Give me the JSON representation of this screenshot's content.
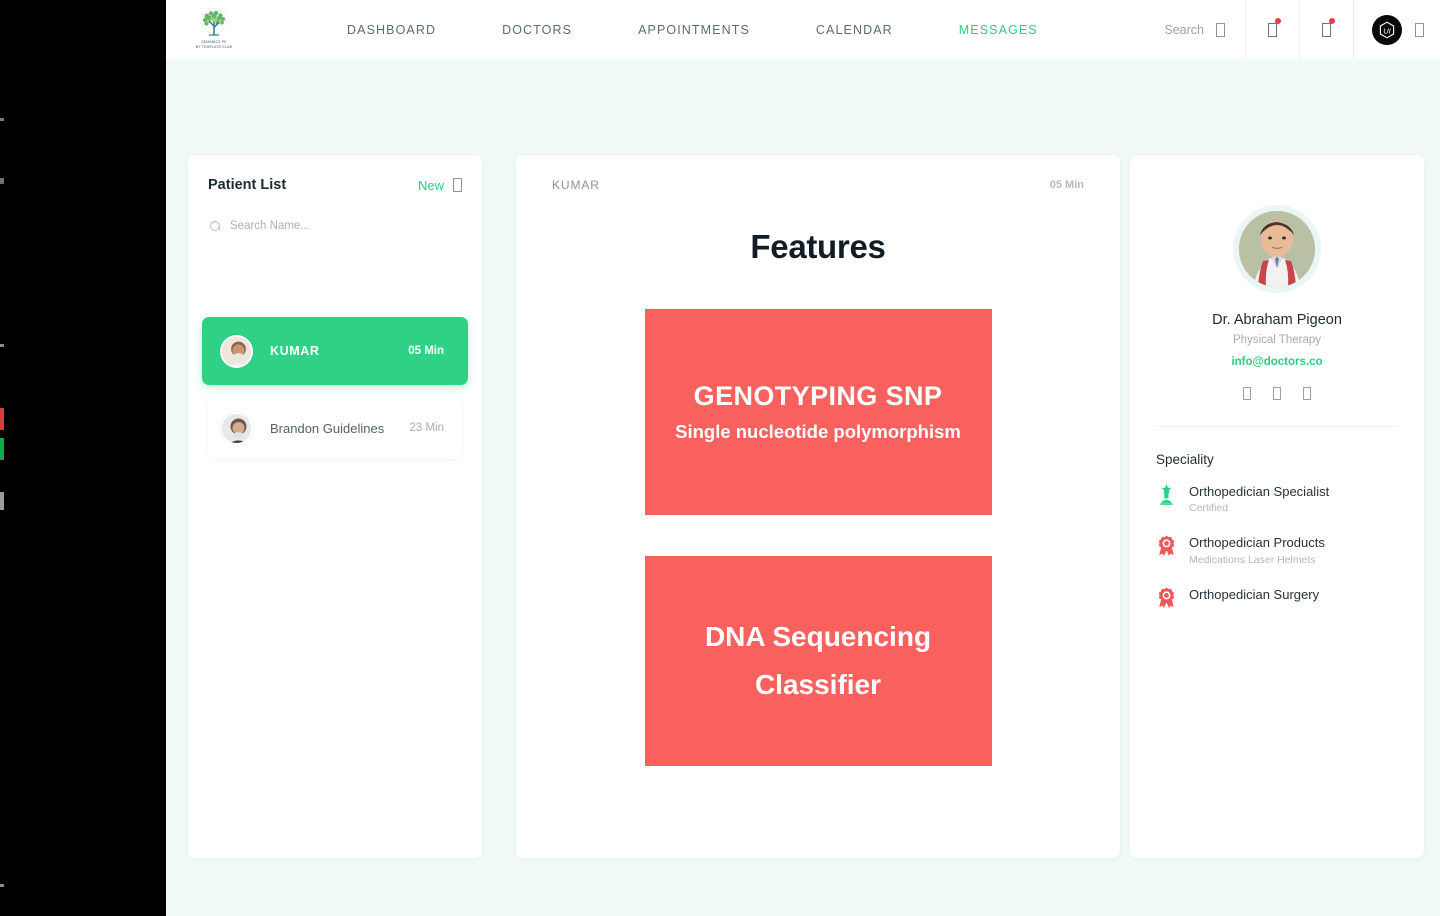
{
  "header": {
    "logo_name": "clinic-tree-logo",
    "logo_caption_line1": "SEMANICS PE",
    "logo_caption_line2": "BY TEMPLATE CLUB",
    "nav": [
      {
        "label": "DASHBOARD",
        "active": false
      },
      {
        "label": "DOCTORS",
        "active": false
      },
      {
        "label": "APPOINTMENTS",
        "active": false
      },
      {
        "label": "CALENDAR",
        "active": false
      },
      {
        "label": "MESSAGES",
        "active": true
      }
    ],
    "search": {
      "placeholder": "Search",
      "value": ""
    },
    "icons": {
      "search": "search-icon",
      "notifications": "notifications-icon",
      "messages": "messages-icon",
      "profile": "profile-avatar",
      "dropdown": "chevron-down-icon"
    },
    "badge_color": "#ec3a46",
    "accent_color": "#2fcc82"
  },
  "patient_list": {
    "title": "Patient List",
    "new_label": "New",
    "new_icon": "plus-icon",
    "search": {
      "placeholder": "Search Name...",
      "value": ""
    },
    "items": [
      {
        "name": "KUMAR",
        "time": "05 Min",
        "active": true,
        "avatar": "patient-avatar-kumar"
      },
      {
        "name": "Brandon Guidelines",
        "time": "23 Min",
        "active": false,
        "avatar": "patient-avatar-brandon"
      }
    ],
    "active_color": "#2fd285"
  },
  "chat": {
    "contact_name": "KUMAR",
    "timestamp": "05 Min",
    "title": "Features",
    "banners": [
      {
        "name": "genotyping-snp-banner",
        "title": "GENOTYPING  SNP",
        "subtitle": "Single nucleotide polymorphism",
        "color": "#f9615f"
      },
      {
        "name": "dna-sequencing-banner",
        "line1": "DNA Sequencing",
        "line2": "Classifier",
        "color": "#f9615f"
      }
    ]
  },
  "doctor": {
    "avatar": "doctor-avatar",
    "name": "Dr. Abraham Pigeon",
    "role": "Physical Therapy",
    "email": "info@doctors.co",
    "socials": [
      {
        "name": "facebook-icon"
      },
      {
        "name": "twitter-icon"
      },
      {
        "name": "linkedin-icon"
      }
    ],
    "speciality_title": "Speciality",
    "specialities": [
      {
        "label": "Orthopedician Specialist",
        "sub": "Certified",
        "icon": "trophy-star-icon",
        "icon_color": "#2fd285"
      },
      {
        "label": "Orthopedician Products",
        "sub": "Medications Laser Helmets",
        "icon": "award-badge-icon",
        "icon_color": "#f2555a"
      },
      {
        "label": "Orthopedician Surgery",
        "sub": "",
        "icon": "award-badge-icon",
        "icon_color": "#f2555a"
      }
    ]
  }
}
